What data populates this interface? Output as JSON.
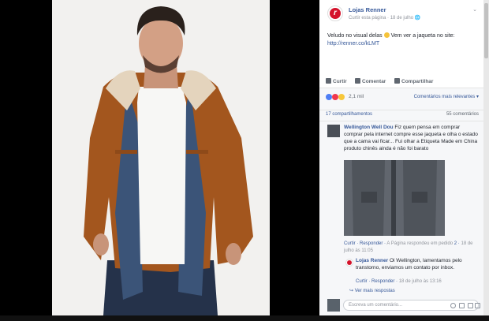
{
  "post": {
    "page_name": "Lojas Renner",
    "like_page": "Curtir esta página",
    "sep": " · ",
    "date": "18 de julho",
    "caption": "Veludo no visual delas",
    "caption_cta": "Vem ver a jaqueta no site:",
    "link": "http://renner.co/kLMT"
  },
  "actions": {
    "like": "Curtir",
    "comment": "Comentar",
    "share": "Compartilhar"
  },
  "reactions": {
    "count": "2,1 mil",
    "sort": "Comentários mais relevantes ▾"
  },
  "stats": {
    "shares": "17 compartilhamentos",
    "comments": "55 comentários"
  },
  "comments": [
    {
      "author": "Wellington Well Dou",
      "text": "Fiz quem pensa em comprar comprar pela internet compre esse jaqueta e olha o estado que a cama vai ficar... Fui olhar a Etiqueta Made em China produto chinês ainda é não foi barato",
      "like": "Curtir",
      "reply": "Responder",
      "page_replied": "A Página respondeu em pedido",
      "reactions": "2",
      "date": "18 de julho às 11:05"
    },
    {
      "author": "Lojas Renner",
      "text": "Oi Wellington, lamentamos pelo transtorno, enviamos um contato por inbox.",
      "like": "Curtir",
      "reply": "Responder",
      "date": "18 de julho às 13:16"
    }
  ],
  "more_label": "Ver mais respostas",
  "composer": {
    "placeholder": "Escreva um comentário..."
  }
}
